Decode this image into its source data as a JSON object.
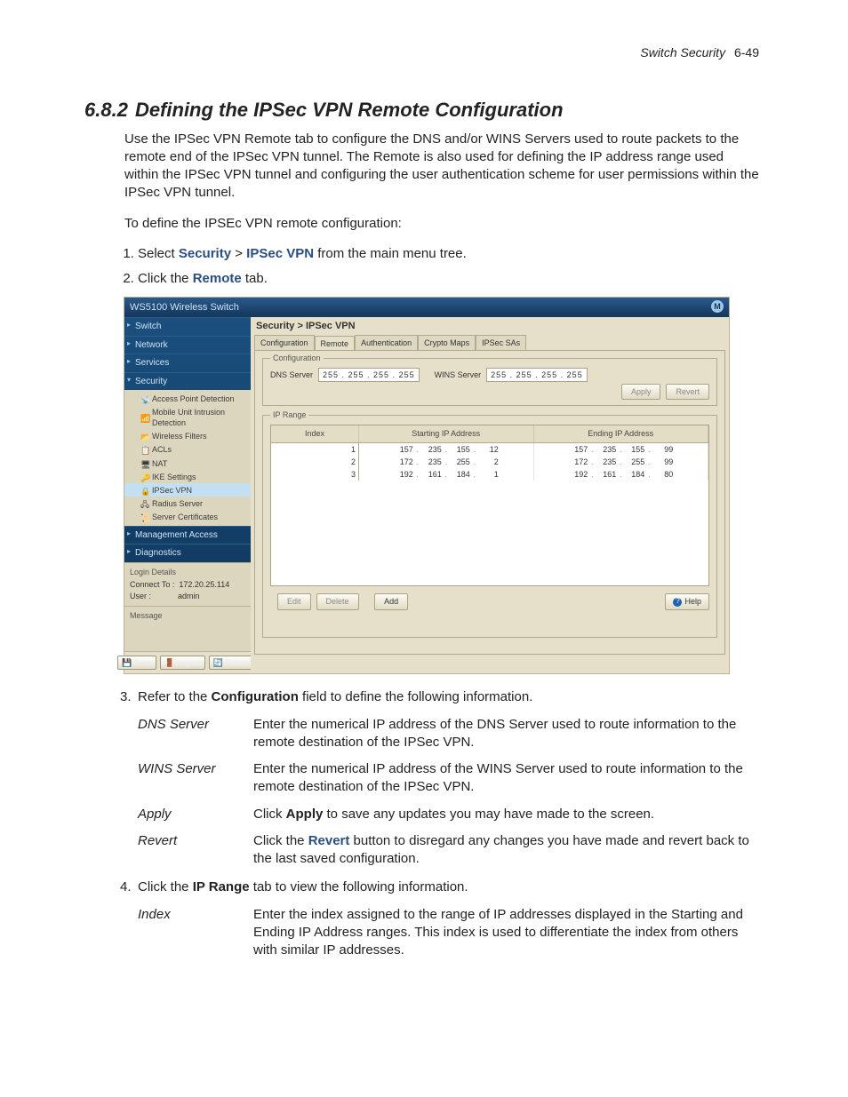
{
  "page_header": {
    "doc_title": "Switch Security",
    "page_ref": "6-49"
  },
  "section": {
    "number": "6.8.2",
    "title": "Defining the IPSec VPN Remote Configuration"
  },
  "intro_para": "Use the IPSec VPN Remote tab to configure the DNS and/or WINS Servers used to route packets to the remote end of the IPSec VPN tunnel. The Remote is also used for defining the IP address range used within the IPSec VPN tunnel and configuring the user authentication scheme for user permissions within the IPSec VPN tunnel.",
  "lead_in": "To define the IPSEc VPN remote configuration:",
  "steps_a": [
    {
      "pre": "Select ",
      "b1": "Security",
      "mid": " > ",
      "b2": "IPSec VPN",
      "post": " from the main menu tree."
    },
    {
      "pre": "Click the ",
      "b1": "Remote",
      "post": " tab."
    }
  ],
  "screenshot": {
    "product": "WS5100 Wireless Switch",
    "logo": "M",
    "nav": [
      {
        "label": "Switch",
        "state": "collapsed"
      },
      {
        "label": "Network",
        "state": "collapsed"
      },
      {
        "label": "Services",
        "state": "collapsed"
      },
      {
        "label": "Security",
        "state": "expanded"
      }
    ],
    "security_children": [
      "Access Point Detection",
      "Mobile Unit Intrusion Detection",
      "Wireless Filters",
      "ACLs",
      "NAT",
      "IKE Settings",
      "IPSec VPN",
      "Radius Server",
      "Server Certificates"
    ],
    "nav_after": [
      {
        "label": "Management Access",
        "state": "collapsed"
      },
      {
        "label": "Diagnostics",
        "state": "collapsed"
      }
    ],
    "login": {
      "header": "Login Details",
      "connect_to_label": "Connect To :",
      "connect_to": "172.20.25.114",
      "user_label": "User :",
      "user": "admin",
      "msg_header": "Message"
    },
    "side_buttons": {
      "save": "Save",
      "logout": "Logout",
      "refresh": "Refresh"
    },
    "breadcrumb": "Security > IPSec VPN",
    "tabs": [
      "Configuration",
      "Remote",
      "Authentication",
      "Crypto Maps",
      "IPSec SAs"
    ],
    "active_tab": 1,
    "config_group": {
      "legend": "Configuration",
      "dns_label": "DNS Server",
      "dns": "255 . 255 . 255 . 255",
      "wins_label": "WINS Server",
      "wins": "255 . 255 . 255 . 255",
      "apply": "Apply",
      "revert": "Revert"
    },
    "ip_group": {
      "legend": "IP Range",
      "headers": [
        "Index",
        "Starting IP Address",
        "Ending IP Address"
      ],
      "rows": [
        {
          "idx": "1",
          "start": [
            "157",
            "235",
            "155",
            "12"
          ],
          "end": [
            "157",
            "235",
            "155",
            "99"
          ]
        },
        {
          "idx": "2",
          "start": [
            "172",
            "235",
            "255",
            "2"
          ],
          "end": [
            "172",
            "235",
            "255",
            "99"
          ]
        },
        {
          "idx": "3",
          "start": [
            "192",
            "161",
            "184",
            "1"
          ],
          "end": [
            "192",
            "161",
            "184",
            "80"
          ]
        }
      ],
      "buttons": {
        "edit": "Edit",
        "delete": "Delete",
        "add": "Add",
        "help": "Help"
      }
    }
  },
  "step3": {
    "num": "3.",
    "pre": "Refer to the ",
    "bold": "Configuration",
    "post": " field to define the following information."
  },
  "defs_a": [
    {
      "term": "DNS Server",
      "desc": "Enter the numerical IP address of the DNS Server used to route information to the remote destination of the IPSec VPN."
    },
    {
      "term": "WINS Server",
      "desc": "Enter the numerical IP address of the WINS Server used to route information to the remote destination of the IPSec VPN."
    },
    {
      "term": "Apply",
      "desc_pre": "Click ",
      "desc_b": "Apply",
      "desc_post": " to save any updates you may have made to the screen."
    },
    {
      "term": "Revert",
      "desc_pre": "Click the ",
      "desc_b": "Revert",
      "desc_post": " button to disregard any changes you have made and revert back to the last saved configuration."
    }
  ],
  "step4": {
    "num": "4.",
    "pre": "Click the ",
    "bold": "IP Range",
    "post": " tab to view the following information."
  },
  "defs_b": [
    {
      "term": "Index",
      "desc": "Enter the index assigned to the range of IP addresses displayed in the Starting and Ending IP Address ranges. This index is used to differentiate the index from others with similar IP addresses."
    }
  ]
}
